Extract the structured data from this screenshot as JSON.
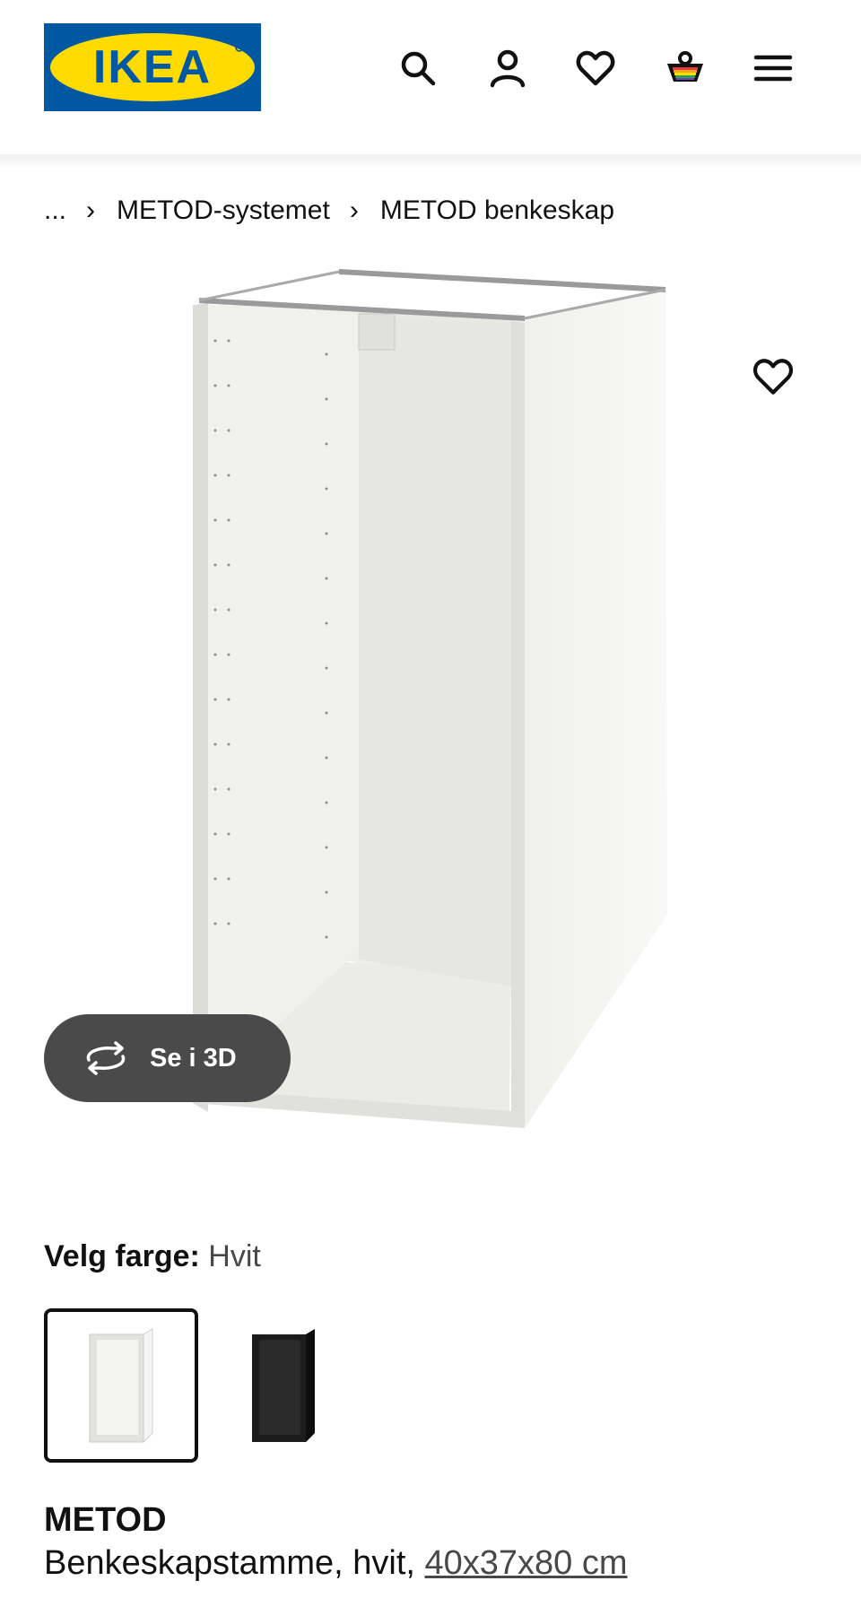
{
  "header": {
    "brand": "IKEA",
    "brand_colors": {
      "blue": "#0058a3",
      "yellow": "#ffdb00"
    },
    "icons": [
      "search-icon",
      "user-icon",
      "heart-icon",
      "basket-icon",
      "menu-icon"
    ]
  },
  "breadcrumb": {
    "ellipsis": "...",
    "items": [
      "METOD-systemet",
      "METOD benkeskap"
    ]
  },
  "product_image": {
    "view_3d_label": "Se i 3D"
  },
  "color_selection": {
    "label": "Velg farge:",
    "value": "Hvit",
    "options": [
      {
        "name": "Hvit",
        "color": "#e9e9e6",
        "selected": true
      },
      {
        "name": "Svart",
        "color": "#1c1c1c",
        "selected": false
      }
    ]
  },
  "product": {
    "name": "METOD",
    "description": "Benkeskapstamme, hvit, ",
    "dimensions": "40x37x80 cm"
  }
}
